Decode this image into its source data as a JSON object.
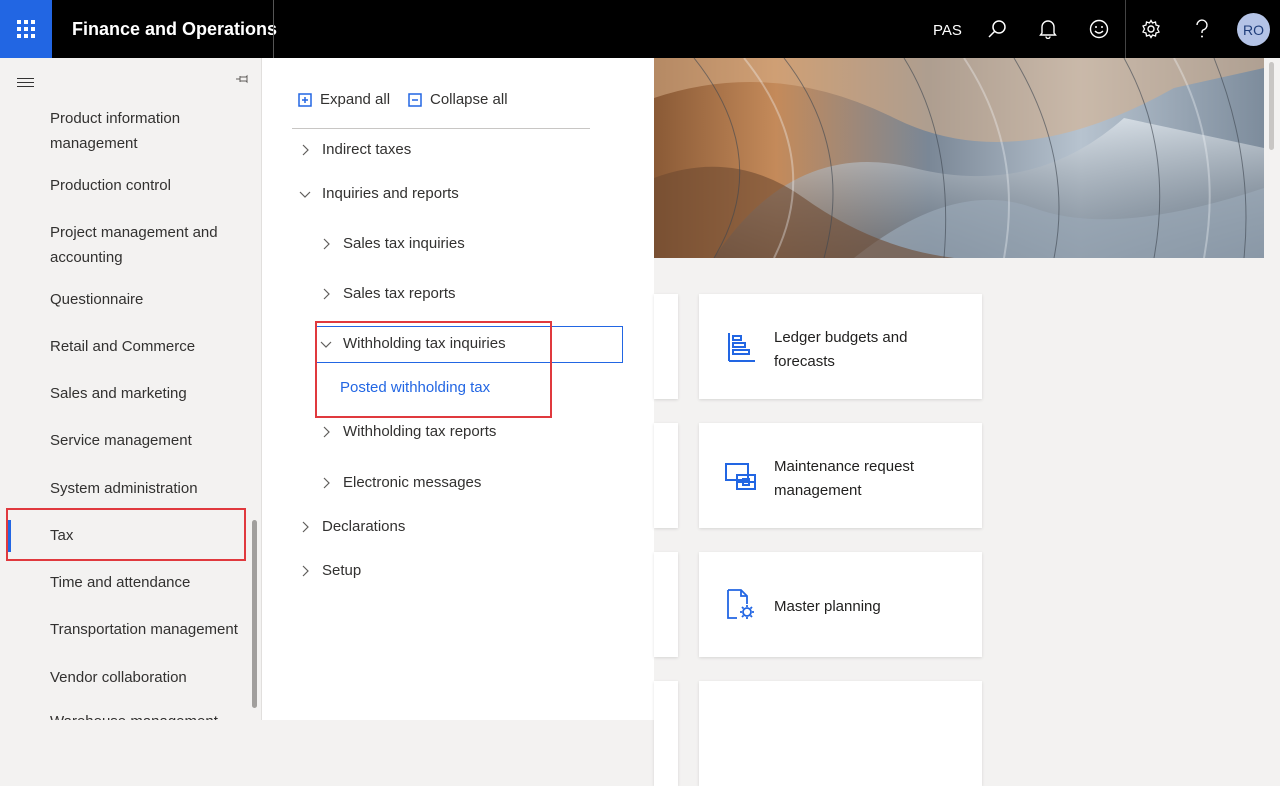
{
  "header": {
    "app_title": "Finance and Operations",
    "company": "PAS",
    "avatar_initials": "RO",
    "icons": [
      "waffle-icon",
      "search-icon",
      "bell-icon",
      "smiley-icon",
      "gear-icon",
      "help-icon"
    ]
  },
  "leftnav": {
    "items": [
      {
        "label": "Product information management"
      },
      {
        "label": "Production control"
      },
      {
        "label": "Project management and accounting"
      },
      {
        "label": "Questionnaire"
      },
      {
        "label": "Retail and Commerce"
      },
      {
        "label": "Sales and marketing"
      },
      {
        "label": "Service management"
      },
      {
        "label": "System administration"
      },
      {
        "label": "Tax"
      },
      {
        "label": "Time and attendance"
      },
      {
        "label": "Transportation management"
      },
      {
        "label": "Vendor collaboration"
      },
      {
        "label": "Warehouse management"
      }
    ],
    "active_item": "Tax"
  },
  "flyout": {
    "expand_all": "Expand all",
    "collapse_all": "Collapse all",
    "tree": {
      "indirect_taxes": "Indirect taxes",
      "inquiries_and_reports": "Inquiries and reports",
      "sales_tax_inquiries": "Sales tax inquiries",
      "sales_tax_reports": "Sales tax reports",
      "withholding_tax_inquiries": "Withholding tax inquiries",
      "posted_withholding_tax": "Posted withholding tax",
      "withholding_tax_reports": "Withholding tax reports",
      "electronic_messages": "Electronic messages",
      "declarations": "Declarations",
      "setup": "Setup"
    }
  },
  "tiles": {
    "ledger_budgets": "Ledger budgets and forecasts",
    "maintenance_request": "Maintenance request management",
    "master_planning": "Master planning"
  },
  "colors": {
    "accent": "#2266e3",
    "highlight_red": "#e0393e",
    "topbar": "#000000"
  }
}
